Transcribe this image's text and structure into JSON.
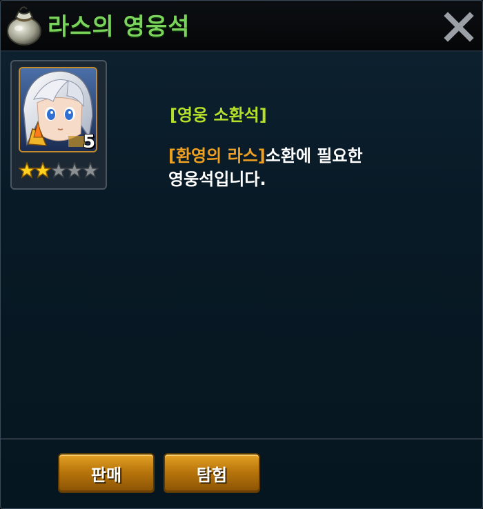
{
  "window": {
    "title": "라스의 영웅석",
    "icon": "money-bag-icon",
    "close_icon": "close-icon"
  },
  "item": {
    "count": "5",
    "stars_filled": 2,
    "stars_total": 5
  },
  "description": {
    "category": "[영웅 소환석]",
    "hero_name": "[환영의 라스]",
    "text_part1": "소환에 필요한",
    "text_part2": "영웅석입니다."
  },
  "actions": {
    "sell_label": "판매",
    "explore_label": "탐험"
  },
  "colors": {
    "title": "#7ad35a",
    "category": "#b6e02a",
    "highlight": "#f0a020",
    "button": "#c2800f"
  }
}
